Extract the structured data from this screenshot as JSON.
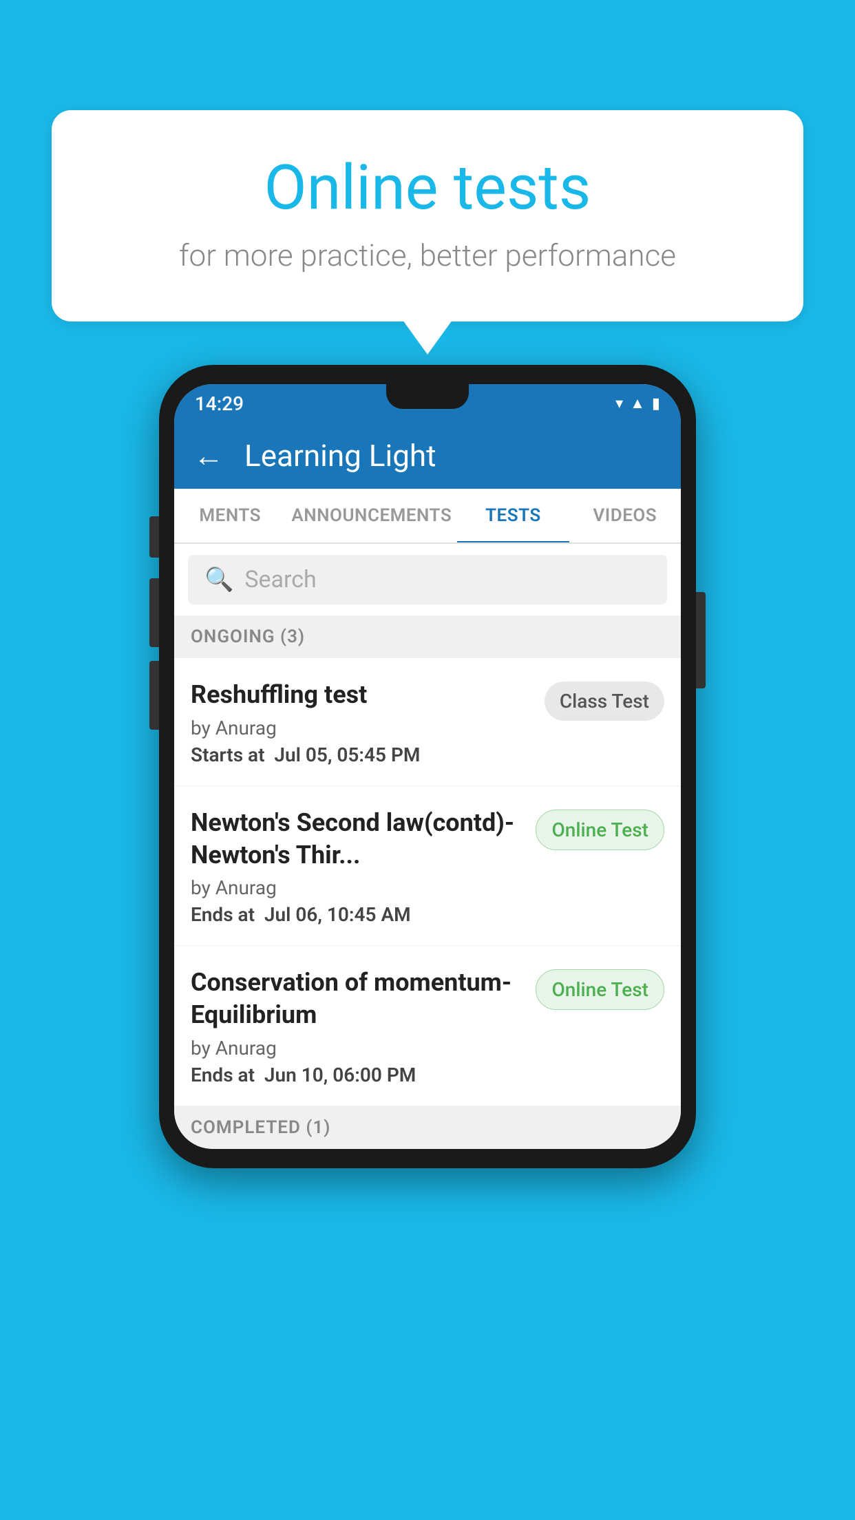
{
  "background_color": "#1ab8e8",
  "bubble": {
    "title": "Online tests",
    "subtitle": "for more practice, better performance"
  },
  "status_bar": {
    "time": "14:29",
    "icons": [
      "wifi",
      "signal",
      "battery"
    ]
  },
  "header": {
    "title": "Learning Light",
    "back_label": "←"
  },
  "tabs": [
    {
      "label": "MENTS",
      "active": false
    },
    {
      "label": "ANNOUNCEMENTS",
      "active": false
    },
    {
      "label": "TESTS",
      "active": true
    },
    {
      "label": "VIDEOS",
      "active": false
    }
  ],
  "search": {
    "placeholder": "Search"
  },
  "ongoing_section": {
    "label": "ONGOING (3)"
  },
  "tests": [
    {
      "name": "Reshuffling test",
      "by": "by Anurag",
      "date_label": "Starts at",
      "date_value": "Jul 05, 05:45 PM",
      "badge": "Class Test",
      "badge_type": "class"
    },
    {
      "name": "Newton's Second law(contd)-Newton's Thir...",
      "by": "by Anurag",
      "date_label": "Ends at",
      "date_value": "Jul 06, 10:45 AM",
      "badge": "Online Test",
      "badge_type": "online"
    },
    {
      "name": "Conservation of momentum-Equilibrium",
      "by": "by Anurag",
      "date_label": "Ends at",
      "date_value": "Jun 10, 06:00 PM",
      "badge": "Online Test",
      "badge_type": "online"
    }
  ],
  "completed_section": {
    "label": "COMPLETED (1)"
  }
}
